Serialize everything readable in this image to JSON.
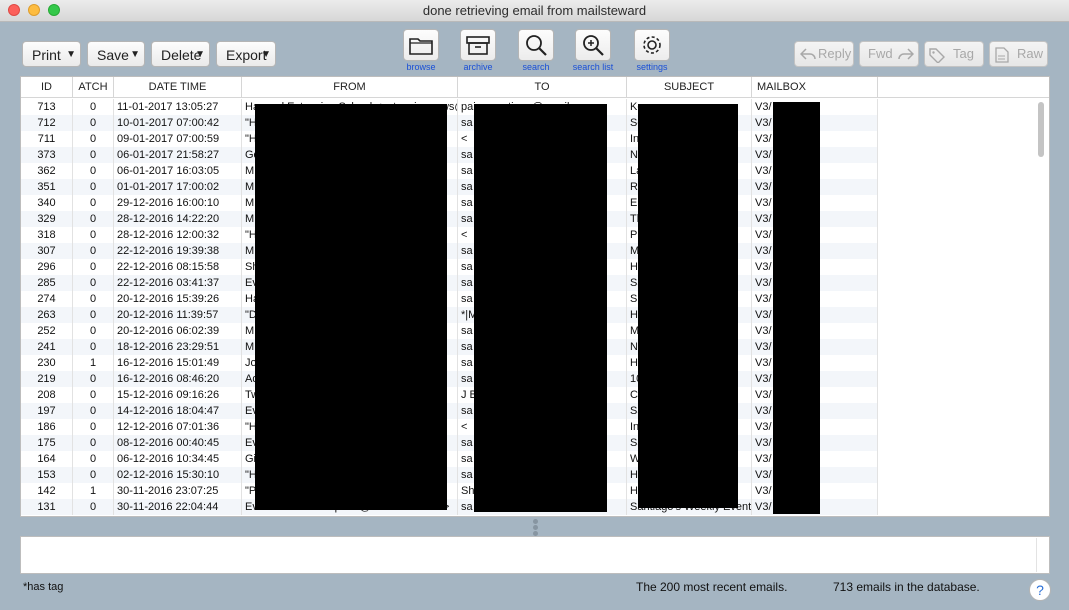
{
  "window": {
    "title": "done retrieving email from mailsteward"
  },
  "toolbar": {
    "dropdowns": [
      {
        "label": "Print",
        "name": "print-menu"
      },
      {
        "label": "Save",
        "name": "save-menu"
      },
      {
        "label": "Delete",
        "name": "delete-menu"
      },
      {
        "label": "Export",
        "name": "export-menu"
      }
    ],
    "tools": [
      {
        "label": "browse",
        "icon": "folder-icon"
      },
      {
        "label": "archive",
        "icon": "archive-box-icon"
      },
      {
        "label": "search",
        "icon": "magnifier-icon"
      },
      {
        "label": "search list",
        "icon": "zoom-in-icon"
      },
      {
        "label": "settings",
        "icon": "gear-icon"
      }
    ],
    "actions": [
      {
        "label": "Reply",
        "icon": "reply-arrow-icon"
      },
      {
        "label": "Fwd",
        "icon": "forward-arrow-icon"
      },
      {
        "label": "Tag",
        "icon": "tag-icon"
      },
      {
        "label": "Raw",
        "icon": "document-icon"
      }
    ],
    "accent_color": "#1a4fd6"
  },
  "table": {
    "columns": [
      "ID",
      "ATCH",
      "DATE TIME",
      "FROM",
      "TO",
      "SUBJECT",
      "MAILBOX"
    ],
    "rows": [
      {
        "id": "713",
        "atch": "0",
        "datetime": "11-01-2017 13:05:27",
        "from": "Harvard Extension School <extensionnews@",
        "to": "paiva.santiago@gmail.com",
        "subject": "Ke",
        "mailbox": "V3/"
      },
      {
        "id": "712",
        "atch": "0",
        "datetime": "10-01-2017 07:00:42",
        "from": "\"H",
        "to": "sa",
        "subject": "So",
        "mailbox": "V3/"
      },
      {
        "id": "711",
        "atch": "0",
        "datetime": "09-01-2017 07:00:59",
        "from": "\"H",
        "to": "<",
        "subject": "In",
        "mailbox": "V3/"
      },
      {
        "id": "373",
        "atch": "0",
        "datetime": "06-01-2017 21:58:27",
        "from": "Go",
        "to": "sa",
        "subject": "Ne",
        "mailbox": "V3/"
      },
      {
        "id": "362",
        "atch": "0",
        "datetime": "06-01-2017 16:03:05",
        "from": "M",
        "to": "sa",
        "subject": "La",
        "mailbox": "V3/"
      },
      {
        "id": "351",
        "atch": "0",
        "datetime": "01-01-2017 17:00:02",
        "from": "M",
        "to": "sa",
        "subject": "Re",
        "mailbox": "V3/"
      },
      {
        "id": "340",
        "atch": "0",
        "datetime": "29-12-2016 16:00:10",
        "from": "M",
        "to": "sa",
        "subject": "En",
        "mailbox": "V3/"
      },
      {
        "id": "329",
        "atch": "0",
        "datetime": "28-12-2016 14:22:20",
        "from": "M",
        "to": "sa",
        "subject": "Th",
        "mailbox": "V3/"
      },
      {
        "id": "318",
        "atch": "0",
        "datetime": "28-12-2016 12:00:32",
        "from": "\"H",
        "to": "<",
        "subject": "Pi",
        "mailbox": "V3/"
      },
      {
        "id": "307",
        "atch": "0",
        "datetime": "22-12-2016 19:39:38",
        "from": "M",
        "to": "sa",
        "subject": "M",
        "mailbox": "V3/"
      },
      {
        "id": "296",
        "atch": "0",
        "datetime": "22-12-2016 08:15:58",
        "from": "Sh",
        "to": "sa",
        "subject": "Ha",
        "mailbox": "V3/"
      },
      {
        "id": "285",
        "atch": "0",
        "datetime": "22-12-2016 03:41:37",
        "from": "Ev",
        "to": "sa",
        "subject": "Sa",
        "mailbox": "V3/"
      },
      {
        "id": "274",
        "atch": "0",
        "datetime": "20-12-2016 15:39:26",
        "from": "Ha",
        "to": "sa",
        "subject": "Sp",
        "mailbox": "V3/"
      },
      {
        "id": "263",
        "atch": "0",
        "datetime": "20-12-2016 11:39:57",
        "from": "\"D",
        "to": "*|M",
        "subject": "Ha",
        "mailbox": "V3/"
      },
      {
        "id": "252",
        "atch": "0",
        "datetime": "20-12-2016 06:02:39",
        "from": "M",
        "to": "sa",
        "subject": "M",
        "mailbox": "V3/"
      },
      {
        "id": "241",
        "atch": "0",
        "datetime": "18-12-2016 23:29:51",
        "from": "M",
        "to": "sa",
        "subject": "Ne",
        "mailbox": "V3/"
      },
      {
        "id": "230",
        "atch": "1",
        "datetime": "16-12-2016 15:01:49",
        "from": "Jo",
        "to": "sa",
        "subject": "Ha",
        "mailbox": "V3/"
      },
      {
        "id": "219",
        "atch": "0",
        "datetime": "16-12-2016 08:46:20",
        "from": "Ad",
        "to": "sa",
        "subject": "10",
        "mailbox": "V3/"
      },
      {
        "id": "208",
        "atch": "0",
        "datetime": "15-12-2016 09:16:26",
        "from": "Tw",
        "to": "J B",
        "subject": "Co",
        "mailbox": "V3/"
      },
      {
        "id": "197",
        "atch": "0",
        "datetime": "14-12-2016 18:04:47",
        "from": "Ev",
        "to": "sa",
        "subject": "Sa",
        "mailbox": "V3/"
      },
      {
        "id": "186",
        "atch": "0",
        "datetime": "12-12-2016 07:01:36",
        "from": "\"H",
        "to": "<",
        "subject": "In",
        "mailbox": "V3/"
      },
      {
        "id": "175",
        "atch": "0",
        "datetime": "08-12-2016 00:40:45",
        "from": "Ev",
        "to": "sa",
        "subject": "Sa",
        "mailbox": "V3/"
      },
      {
        "id": "164",
        "atch": "0",
        "datetime": "06-12-2016 10:34:45",
        "from": "Gi",
        "to": "sa",
        "subject": "W",
        "mailbox": "V3/"
      },
      {
        "id": "153",
        "atch": "0",
        "datetime": "02-12-2016 15:30:10",
        "from": "\"H",
        "to": "sa",
        "subject": "He",
        "mailbox": "V3/"
      },
      {
        "id": "142",
        "atch": "1",
        "datetime": "30-11-2016 23:07:25",
        "from": "\"P",
        "to": "Sh",
        "subject": "Ha",
        "mailbox": "V3/"
      },
      {
        "id": "131",
        "atch": "0",
        "datetime": "30-11-2016 22:04:44",
        "from": "EventBrite Picks <picks@eventbrite.com>",
        "to": "sa",
        "subject": "Santiago's Weekly Event G",
        "mailbox": "V3/"
      }
    ]
  },
  "preview": {
    "text": ""
  },
  "footer": {
    "tag_note": "*has tag",
    "recent_count": "The 200 most recent emails.",
    "db_count": "713 emails in the database.",
    "help_label": "?"
  }
}
